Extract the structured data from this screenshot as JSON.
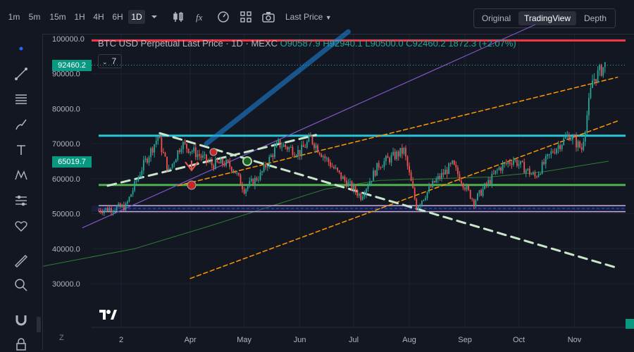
{
  "toolbar": {
    "timeframes": [
      "1m",
      "5m",
      "15m",
      "1H",
      "4H",
      "6H",
      "1D"
    ],
    "active_timeframe": "1D",
    "price_type": "Last Price",
    "views": [
      "Original",
      "TradingView",
      "Depth"
    ],
    "active_view": "TradingView",
    "icons": [
      "chevron-down-icon",
      "candlestick-icon",
      "function-icon",
      "gauge-icon",
      "grid-icon",
      "camera-icon",
      "caret-down-icon"
    ]
  },
  "left_tools": [
    "dot-icon",
    "trendline-icon",
    "fib-icon",
    "brush-icon",
    "text-icon",
    "pattern-icon",
    "forecast-icon",
    "heart-icon",
    "ruler-icon",
    "zoom-icon",
    "magnet-icon",
    "lock-icon"
  ],
  "legend": {
    "symbol": "BTC USD Perpetual Last Price · 1D · MEXC",
    "o": "O90587.9",
    "h": "H92940.1",
    "l": "L90500.0",
    "c": "C92460.2",
    "chg": "1872.3 (+2.07%)",
    "indicator_count": "7"
  },
  "axis_badges": {
    "last": "92460.2",
    "mark": "65019.7"
  },
  "zoom_label": "Z",
  "colors": {
    "bg": "#131722",
    "up": "#26a69a",
    "down": "#ef5350",
    "cyan": "#26c6da",
    "green": "#4caf50",
    "red": "#f23645",
    "orange": "#ff9800",
    "purple": "#7e57c2",
    "pink": "#e1bee7",
    "dashgreen": "#c8e6c9",
    "blue": "#2962ff"
  },
  "chart_data": {
    "type": "candlestick",
    "title": "BTC USD Perpetual Last Price · 1D · MEXC",
    "ylim": [
      24000,
      103000
    ],
    "y_ticks": [
      100000,
      90000,
      80000,
      70000,
      60000,
      50000,
      40000,
      30000
    ],
    "y_tick_labels": [
      "100000.0",
      "90000.0",
      "80000.0",
      "70000.0",
      "60000.0",
      "50000.0",
      "40000.0",
      "30000.0"
    ],
    "x_ticks": [
      "2",
      "Apr",
      "May",
      "Jun",
      "Jul",
      "Aug",
      "Sep",
      "Oct",
      "Nov"
    ],
    "x_tick_months": [
      2,
      4,
      5,
      6,
      7,
      8,
      9,
      10,
      11
    ],
    "close_path": [
      [
        "2024-02-10",
        51000
      ],
      [
        "2024-02-25",
        52000
      ],
      [
        "2024-03-05",
        63000
      ],
      [
        "2024-03-14",
        72000
      ],
      [
        "2024-03-20",
        62000
      ],
      [
        "2024-03-27",
        70000
      ],
      [
        "2024-04-05",
        67000
      ],
      [
        "2024-04-13",
        64000
      ],
      [
        "2024-04-20",
        64500
      ],
      [
        "2024-04-25",
        63000
      ],
      [
        "2024-05-01",
        57000
      ],
      [
        "2024-05-10",
        61000
      ],
      [
        "2024-05-20",
        70000
      ],
      [
        "2024-06-01",
        67500
      ],
      [
        "2024-06-07",
        71500
      ],
      [
        "2024-06-15",
        66000
      ],
      [
        "2024-06-24",
        60500
      ],
      [
        "2024-07-05",
        55000
      ],
      [
        "2024-07-15",
        64000
      ],
      [
        "2024-07-29",
        68000
      ],
      [
        "2024-08-05",
        52000
      ],
      [
        "2024-08-15",
        59000
      ],
      [
        "2024-08-25",
        64000
      ],
      [
        "2024-09-06",
        53500
      ],
      [
        "2024-09-20",
        63000
      ],
      [
        "2024-09-28",
        65500
      ],
      [
        "2024-10-10",
        60500
      ],
      [
        "2024-10-20",
        68000
      ],
      [
        "2024-10-29",
        72500
      ],
      [
        "2024-11-05",
        68500
      ],
      [
        "2024-11-11",
        88000
      ],
      [
        "2024-11-18",
        92460
      ]
    ],
    "ma_path": [
      [
        "2024-01-10",
        35000
      ],
      [
        "2024-03-01",
        40000
      ],
      [
        "2024-04-15",
        47000
      ],
      [
        "2024-05-15",
        52000
      ],
      [
        "2024-06-15",
        57000
      ],
      [
        "2024-07-15",
        59500
      ],
      [
        "2024-08-15",
        60000
      ],
      [
        "2024-09-15",
        60500
      ],
      [
        "2024-10-15",
        62000
      ],
      [
        "2024-11-20",
        65000
      ]
    ],
    "levels": [
      {
        "name": "resistance-red",
        "y": 99500
      },
      {
        "name": "resistance-cyan",
        "y": 72300
      },
      {
        "name": "support-green",
        "y": 58200
      },
      {
        "name": "support-pink-top",
        "y": 52300
      },
      {
        "name": "support-band-blue",
        "y": 51500
      },
      {
        "name": "support-pink-bottom",
        "y": 50600
      }
    ],
    "trendlines": [
      {
        "name": "orange-upper-channel",
        "from": [
          "2024-03-25",
          58000
        ],
        "to": [
          "2024-11-25",
          89000
        ]
      },
      {
        "name": "orange-lower-channel",
        "from": [
          "2024-04-01",
          31500
        ],
        "to": [
          "2024-11-25",
          76500
        ]
      },
      {
        "name": "purple-trendline",
        "from": [
          "2024-02-01",
          46000
        ],
        "to": [
          "2024-10-10",
          104000
        ]
      },
      {
        "name": "dashed-green-falling",
        "from": [
          "2024-03-15",
          73000
        ],
        "to": [
          "2024-11-25",
          34500
        ]
      },
      {
        "name": "dashed-green-rising",
        "from": [
          "2024-02-15",
          58000
        ],
        "to": [
          "2024-06-10",
          72500
        ]
      },
      {
        "name": "blue-thick-arrow",
        "from": [
          "2024-04-10",
          70000
        ],
        "to": [
          "2024-06-28",
          102000
        ]
      }
    ]
  }
}
